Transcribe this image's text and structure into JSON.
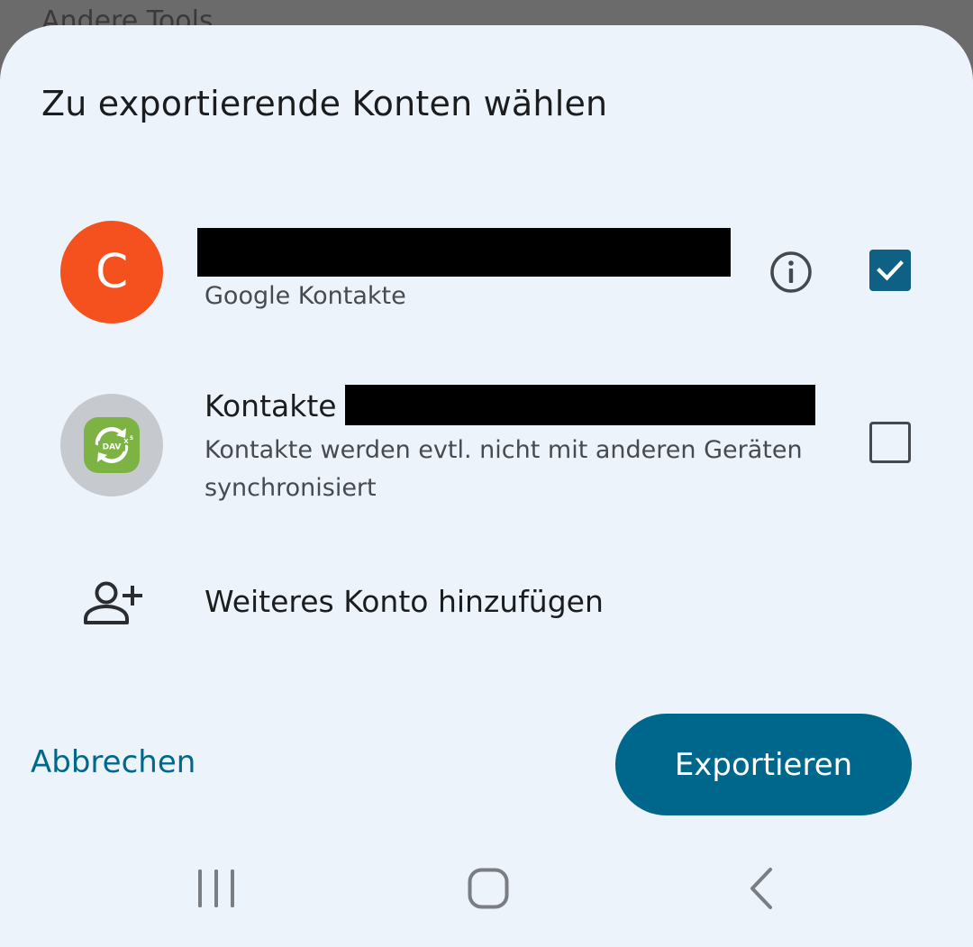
{
  "background": {
    "partial_text": "Andere Tools"
  },
  "dialog": {
    "title": "Zu exportierende Konten wählen",
    "accounts": [
      {
        "avatar_letter": "C",
        "avatar_color": "#f4511e",
        "name_redacted": true,
        "subtitle": "Google Kontakte",
        "has_info_icon": true,
        "checked": true
      },
      {
        "avatar_icon": "davx5-icon",
        "title_prefix": "Kontakte",
        "name_redacted": true,
        "subtitle": "Kontakte werden evtl. nicht mit anderen Geräten synchronisiert",
        "checked": false
      }
    ],
    "add_account": {
      "label": "Weiteres Konto hinzufügen",
      "icon": "add-person-icon"
    },
    "buttons": {
      "cancel": "Abbrechen",
      "export": "Exportieren"
    }
  },
  "navbar": {
    "icons": [
      "recents-icon",
      "home-icon",
      "back-icon"
    ]
  },
  "colors": {
    "accent": "#00678c",
    "checkbox_checked": "#0e6184",
    "sheet_background": "#edf3fb",
    "scrim": "#6b6b6b"
  }
}
